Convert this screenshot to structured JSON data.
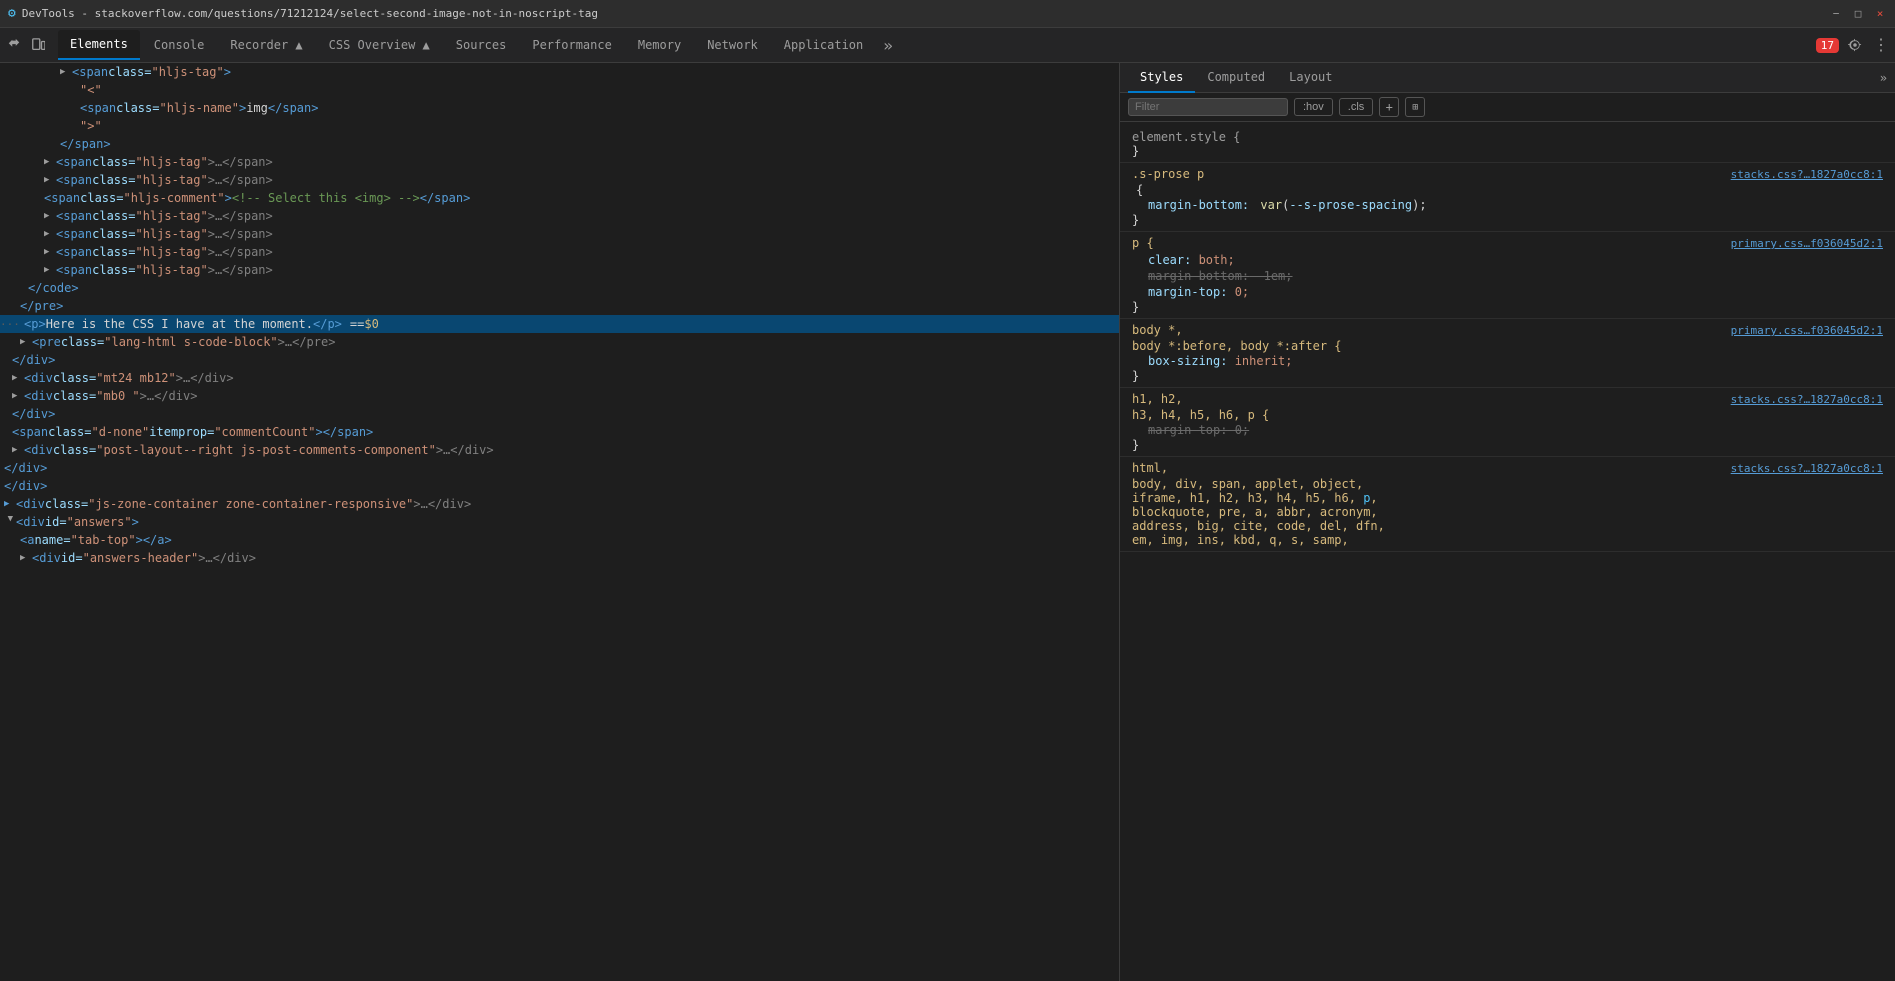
{
  "titleBar": {
    "text": "DevTools - stackoverflow.com/questions/71212124/select-second-image-not-in-noscript-tag",
    "icon": "🔧",
    "minimize": "−",
    "maximize": "□",
    "close": "×"
  },
  "tabs": [
    {
      "id": "elements",
      "label": "Elements",
      "active": true
    },
    {
      "id": "console",
      "label": "Console",
      "active": false
    },
    {
      "id": "recorder",
      "label": "Recorder ▲",
      "active": false
    },
    {
      "id": "css-overview",
      "label": "CSS Overview ▲",
      "active": false
    },
    {
      "id": "sources",
      "label": "Sources",
      "active": false
    },
    {
      "id": "performance",
      "label": "Performance",
      "active": false
    },
    {
      "id": "memory",
      "label": "Memory",
      "active": false
    },
    {
      "id": "network",
      "label": "Network",
      "active": false
    },
    {
      "id": "application",
      "label": "Application",
      "active": false
    }
  ],
  "tabMore": "»",
  "badgeCount": "17",
  "panelTabs": [
    {
      "id": "styles",
      "label": "Styles",
      "active": true
    },
    {
      "id": "computed",
      "label": "Computed",
      "active": false
    },
    {
      "id": "layout",
      "label": "Layout",
      "active": false
    }
  ],
  "panelTabMore": "»",
  "filter": {
    "placeholder": "Filter",
    "hovBtn": ":hov",
    "clsBtn": ".cls"
  },
  "domLines": [
    {
      "indent": 60,
      "content": "span_open_hljs_tag",
      "hasTriangle": false,
      "triangleDir": "",
      "selected": false
    },
    {
      "indent": 80,
      "content": "quote_lt",
      "hasTriangle": false,
      "triangleDir": "",
      "selected": false
    },
    {
      "indent": 80,
      "content": "span_hljs_name_img",
      "hasTriangle": false,
      "triangleDir": "",
      "selected": false
    },
    {
      "indent": 80,
      "content": "quote_gt",
      "hasTriangle": false,
      "triangleDir": "",
      "selected": false
    },
    {
      "indent": 60,
      "content": "span_close",
      "hasTriangle": false,
      "triangleDir": "",
      "selected": false
    },
    {
      "indent": 44,
      "content": "span_hljs_tag_ellipsis_1",
      "hasTriangle": true,
      "triangleDir": "right",
      "selected": false
    },
    {
      "indent": 44,
      "content": "span_hljs_tag_ellipsis_2",
      "hasTriangle": true,
      "triangleDir": "right",
      "selected": false
    },
    {
      "indent": 44,
      "content": "span_hljs_comment",
      "hasTriangle": false,
      "triangleDir": "",
      "selected": false
    },
    {
      "indent": 44,
      "content": "span_hljs_tag_ellipsis_3",
      "hasTriangle": true,
      "triangleDir": "right",
      "selected": false
    },
    {
      "indent": 44,
      "content": "span_hljs_tag_ellipsis_4",
      "hasTriangle": true,
      "triangleDir": "right",
      "selected": false
    },
    {
      "indent": 44,
      "content": "span_hljs_tag_ellipsis_5",
      "hasTriangle": true,
      "triangleDir": "right",
      "selected": false
    },
    {
      "indent": 44,
      "content": "span_hljs_tag_ellipsis_6",
      "hasTriangle": true,
      "triangleDir": "right",
      "selected": false
    },
    {
      "indent": 28,
      "content": "code_close",
      "hasTriangle": false,
      "triangleDir": "",
      "selected": false
    },
    {
      "indent": 20,
      "content": "pre_close",
      "hasTriangle": false,
      "triangleDir": "",
      "selected": false
    },
    {
      "indent": 12,
      "content": "p_selected",
      "hasTriangle": false,
      "triangleDir": "",
      "selected": true,
      "isDots": true
    },
    {
      "indent": 12,
      "content": "pre_class_lang",
      "hasTriangle": true,
      "triangleDir": "right",
      "selected": false
    },
    {
      "indent": 12,
      "content": "div_close",
      "hasTriangle": false,
      "triangleDir": "",
      "selected": false
    },
    {
      "indent": 4,
      "content": "div_mt24_mb12",
      "hasTriangle": true,
      "triangleDir": "right",
      "selected": false
    },
    {
      "indent": 4,
      "content": "div_mb0",
      "hasTriangle": true,
      "triangleDir": "right",
      "selected": false
    },
    {
      "indent": 4,
      "content": "div_close2",
      "hasTriangle": false,
      "triangleDir": "",
      "selected": false
    },
    {
      "indent": 4,
      "content": "span_d_none",
      "hasTriangle": false,
      "triangleDir": "",
      "selected": false
    },
    {
      "indent": 4,
      "content": "div_post_layout",
      "hasTriangle": true,
      "triangleDir": "right",
      "selected": false
    },
    {
      "indent": 4,
      "content": "div_close3",
      "hasTriangle": false,
      "triangleDir": "",
      "selected": false
    },
    {
      "indent": 0,
      "content": "div_close4",
      "hasTriangle": false,
      "triangleDir": "",
      "selected": false
    },
    {
      "indent": 0,
      "content": "div_js_zone",
      "hasTriangle": false,
      "triangleDir": "",
      "selected": false
    },
    {
      "indent": 0,
      "content": "div_answers_open",
      "hasTriangle": true,
      "triangleDir": "down",
      "selected": false
    },
    {
      "indent": 12,
      "content": "a_tab_top",
      "hasTriangle": false,
      "triangleDir": "",
      "selected": false
    },
    {
      "indent": 12,
      "content": "div_answers_header",
      "hasTriangle": true,
      "triangleDir": "right",
      "selected": false
    }
  ],
  "styleRules": [
    {
      "id": "element-style",
      "selector": "element.style {",
      "selectorClass": "element-style-selector",
      "source": "",
      "properties": [],
      "closingBrace": "}"
    },
    {
      "id": "s-prose-p",
      "selector": ".s-prose p",
      "source": "stacks.css?…1827a0cc8:1",
      "properties": [
        {
          "name": "margin-bottom:",
          "value": "var(--s-prose-spacing);",
          "strikethrough": false
        }
      ],
      "closingBrace": "}"
    },
    {
      "id": "p-rule",
      "selector": "p {",
      "source": "primary.css…f036045d2:1",
      "properties": [
        {
          "name": "clear:",
          "value": "both;",
          "strikethrough": false
        },
        {
          "name": "margin-bottom:",
          "value": "-1em;",
          "strikethrough": true
        },
        {
          "name": "margin-top:",
          "value": "0;",
          "strikethrough": false
        }
      ],
      "closingBrace": "}"
    },
    {
      "id": "body-star",
      "selector": "body *,",
      "selectorExtra": "body *:before, body *:after {",
      "source": "primary.css…f036045d2:1",
      "properties": [
        {
          "name": "box-sizing:",
          "value": "inherit;",
          "strikethrough": false
        }
      ],
      "closingBrace": "}"
    },
    {
      "id": "h1-h2",
      "selector": "h1, h2,",
      "selectorExtra": "h3, h4, h5, h6, p {",
      "source": "stacks.css?…1827a0cc8:1",
      "properties": [
        {
          "name": "margin-top:",
          "value": "0;",
          "strikethrough": true
        }
      ],
      "closingBrace": "}"
    },
    {
      "id": "html-rule",
      "selector": "html,",
      "source": "stacks.css?…1827a0cc8:1",
      "properties": [],
      "selectorExtra": "body, div, span, applet, object,",
      "selectorExtra2": "iframe, h1, h2, h3, h4, h5, h6, p,",
      "selectorExtra3": "blockquote, pre, a, abbr, acronym,",
      "selectorExtra4": "address, big, cite, code, del, dfn,",
      "selectorExtra5": "em, img, ins, kbd, q, s, samp,"
    }
  ]
}
